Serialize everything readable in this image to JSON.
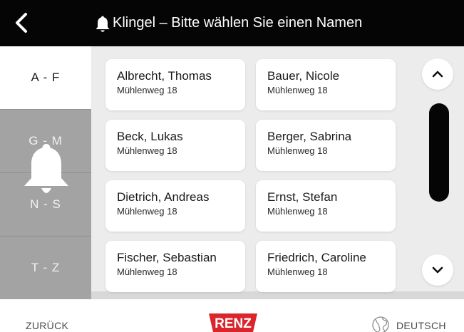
{
  "header": {
    "title": "Klingel – Bitte wählen Sie einen Namen",
    "back_icon": "chevron-left-icon",
    "bell_icon": "bell-icon"
  },
  "sidebar": {
    "tabs": [
      {
        "label": "A - F",
        "active": true
      },
      {
        "label": "G - M",
        "active": false
      },
      {
        "label": "N - S",
        "active": false
      },
      {
        "label": "T - Z",
        "active": false
      }
    ],
    "overlay_icon": "bell-icon"
  },
  "contacts": [
    {
      "name": "Albrecht, Thomas",
      "address": "Mühlenweg 18"
    },
    {
      "name": "Bauer, Nicole",
      "address": "Mühlenweg 18"
    },
    {
      "name": "Beck, Lukas",
      "address": "Mühlenweg 18"
    },
    {
      "name": "Berger, Sabrina",
      "address": "Mühlenweg 18"
    },
    {
      "name": "Dietrich, Andreas",
      "address": "Mühlenweg 18"
    },
    {
      "name": "Ernst, Stefan",
      "address": "Mühlenweg 18"
    },
    {
      "name": "Fischer, Sebastian",
      "address": "Mühlenweg 18"
    },
    {
      "name": "Friedrich, Caroline",
      "address": "Mühlenweg 18"
    }
  ],
  "scroll": {
    "up_icon": "chevron-up-icon",
    "down_icon": "chevron-down-icon"
  },
  "footer": {
    "back_label": "ZURÜCK",
    "logo_text": "RENZ",
    "language_label": "DEUTSCH",
    "language_icon": "globe-icon"
  },
  "colors": {
    "header_bg": "#050505",
    "sidebar_inactive": "#a3a3a3",
    "content_bg": "#ececec",
    "brand_red": "#d9252b"
  }
}
